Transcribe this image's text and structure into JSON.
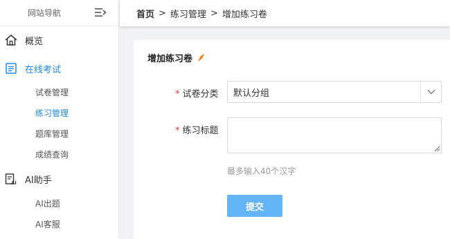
{
  "sidebar": {
    "title": "网站导航",
    "items": [
      {
        "label": "概览",
        "icon": "home-icon"
      },
      {
        "label": "在线考试",
        "icon": "exam-list-icon",
        "active": true,
        "children": [
          {
            "label": "试卷管理"
          },
          {
            "label": "练习管理",
            "active": true
          },
          {
            "label": "题库管理"
          },
          {
            "label": "成绩查询"
          }
        ]
      },
      {
        "label": "AI助手",
        "icon": "ai-assistant-icon",
        "children": [
          {
            "label": "AI出题"
          },
          {
            "label": "AI客服"
          }
        ]
      }
    ]
  },
  "breadcrumb": {
    "items": [
      "首页",
      "练习管理",
      "增加练习卷"
    ],
    "separator": ">"
  },
  "form": {
    "title": "增加练习卷",
    "required_mark": "*",
    "category_label": "试卷分类",
    "category_value": "默认分组",
    "title_label": "练习标题",
    "title_value": "",
    "hint": "最多输入40个汉字",
    "submit_label": "提交"
  },
  "colors": {
    "accent": "#1e88e5",
    "submit_bg": "#64b5f6",
    "required": "#e53935",
    "pen": "#f57c00"
  }
}
